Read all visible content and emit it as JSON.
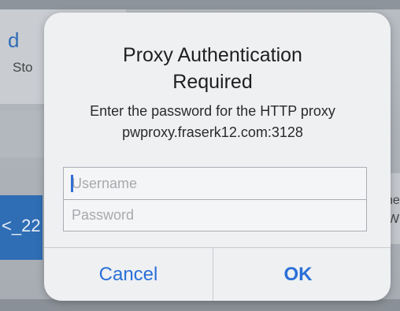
{
  "background": {
    "partial_heading": "d",
    "partial_subtext": "Sto",
    "partial_tile_text": "<_22",
    "partial_right_text_1": "ne",
    "partial_right_text_2": "W"
  },
  "alert": {
    "title_line_1": "Proxy Authentication",
    "title_line_2": "Required",
    "message_line_1": "Enter the password for the HTTP proxy",
    "message_line_2": "pwproxy.fraserk12.com:3128",
    "username_placeholder": "Username",
    "password_placeholder": "Password",
    "cancel_label": "Cancel",
    "ok_label": "OK"
  },
  "colors": {
    "accent": "#2a6fd8",
    "alert_background": "#eef0f2",
    "background_tile": "#2f6db5"
  }
}
